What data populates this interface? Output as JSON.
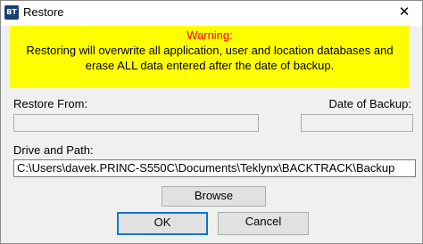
{
  "window": {
    "title": "Restore",
    "icon_text": "BT",
    "close_glyph": "✕"
  },
  "warning": {
    "title": "Warning:",
    "message": "Restoring will overwrite all application, user and location databases and erase ALL data entered after the date of backup."
  },
  "restore_from": {
    "label": "Restore From:",
    "value": ""
  },
  "date_of_backup": {
    "label": "Date of Backup:",
    "value": ""
  },
  "drive_path": {
    "label": "Drive and Path:",
    "value": "C:\\Users\\davek.PRINC-S550C\\Documents\\Teklynx\\BACKTRACK\\Backup"
  },
  "buttons": {
    "browse": "Browse",
    "ok": "OK",
    "cancel": "Cancel"
  },
  "colors": {
    "warning_background": "#ffff00",
    "warning_title": "#ff0000",
    "default_button_border": "#0078d7"
  }
}
